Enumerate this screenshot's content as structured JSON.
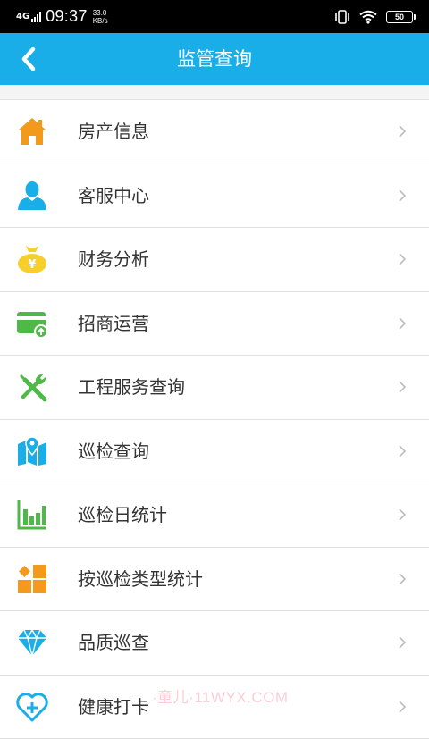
{
  "status_bar": {
    "network": "4G",
    "time": "09:37",
    "speed_value": "33.0",
    "speed_unit": "KB/s",
    "battery": "50",
    "icons": [
      "signal-icon",
      "vibrate-icon",
      "wifi-icon",
      "battery-icon"
    ]
  },
  "header": {
    "title": "监管查询",
    "back_icon": "chevron-left-icon",
    "background": "#1aaee8"
  },
  "menu": {
    "items": [
      {
        "label": "房产信息",
        "icon": "house-icon",
        "color": "#f39a1c"
      },
      {
        "label": "客服中心",
        "icon": "person-icon",
        "color": "#1aaee8"
      },
      {
        "label": "财务分析",
        "icon": "money-bag-icon",
        "color": "#f6cf2b"
      },
      {
        "label": "招商运营",
        "icon": "card-icon",
        "color": "#4fb948"
      },
      {
        "label": "工程服务查询",
        "icon": "tools-icon",
        "color": "#4fb948"
      },
      {
        "label": "巡检查询",
        "icon": "map-pin-icon",
        "color": "#1aaee8"
      },
      {
        "label": "巡检日统计",
        "icon": "bar-chart-icon",
        "color": "#4fb948"
      },
      {
        "label": "按巡检类型统计",
        "icon": "category-grid-icon",
        "color": "#f39a1c"
      },
      {
        "label": "品质巡查",
        "icon": "diamond-icon",
        "color": "#1aaee8"
      },
      {
        "label": "健康打卡",
        "icon": "health-heart-icon",
        "color": "#1aaee8"
      }
    ],
    "chevron_icon": "chevron-right-icon"
  },
  "watermark": "·童儿·11WYX.COM"
}
